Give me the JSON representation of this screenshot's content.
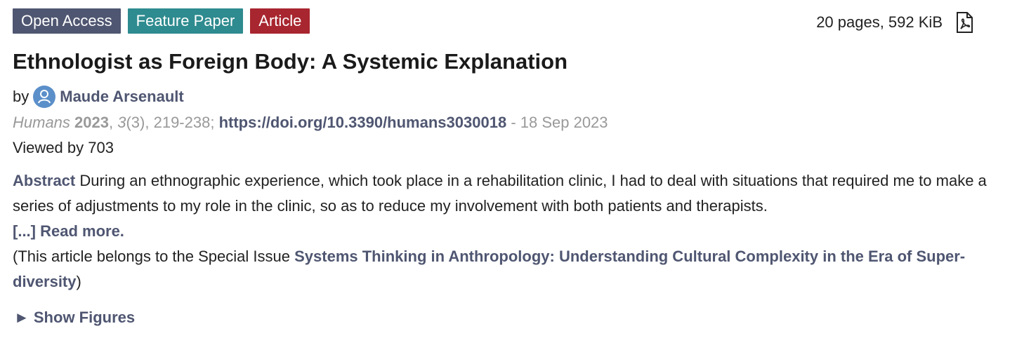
{
  "badges": {
    "open_access": "Open Access",
    "feature_paper": "Feature Paper",
    "article": "Article"
  },
  "pdf": {
    "info": "20 pages, 592 KiB",
    "icon": "pdf-icon"
  },
  "article": {
    "title": "Ethnologist as Foreign Body: A Systemic Explanation",
    "by_label": "by",
    "author": "Maude Arsenault",
    "journal": "Humans",
    "year": "2023",
    "volume": "3",
    "issue_pages": "(3), 219-238;",
    "doi": "https://doi.org/10.3390/humans3030018",
    "date": "- 18 Sep 2023",
    "viewed": "Viewed by 703"
  },
  "abstract": {
    "label": "Abstract",
    "text": "During an ethnographic experience, which took place in a rehabilitation clinic, I had to deal with situations that required me to make a series of adjustments to my role in the clinic, so as to reduce my involvement with both patients and therapists.",
    "read_more": "[...] Read more."
  },
  "special_issue": {
    "prefix": "(This article belongs to the Special Issue",
    "link": "Systems Thinking in Anthropology: Understanding Cultural Complexity in the Era of Super-diversity",
    "suffix": ")"
  },
  "show_figures": "► Show Figures",
  "colors": {
    "open_access": "#4f5671",
    "feature_paper": "#2e8b8f",
    "article": "#a8262f",
    "link": "#4f5671"
  }
}
